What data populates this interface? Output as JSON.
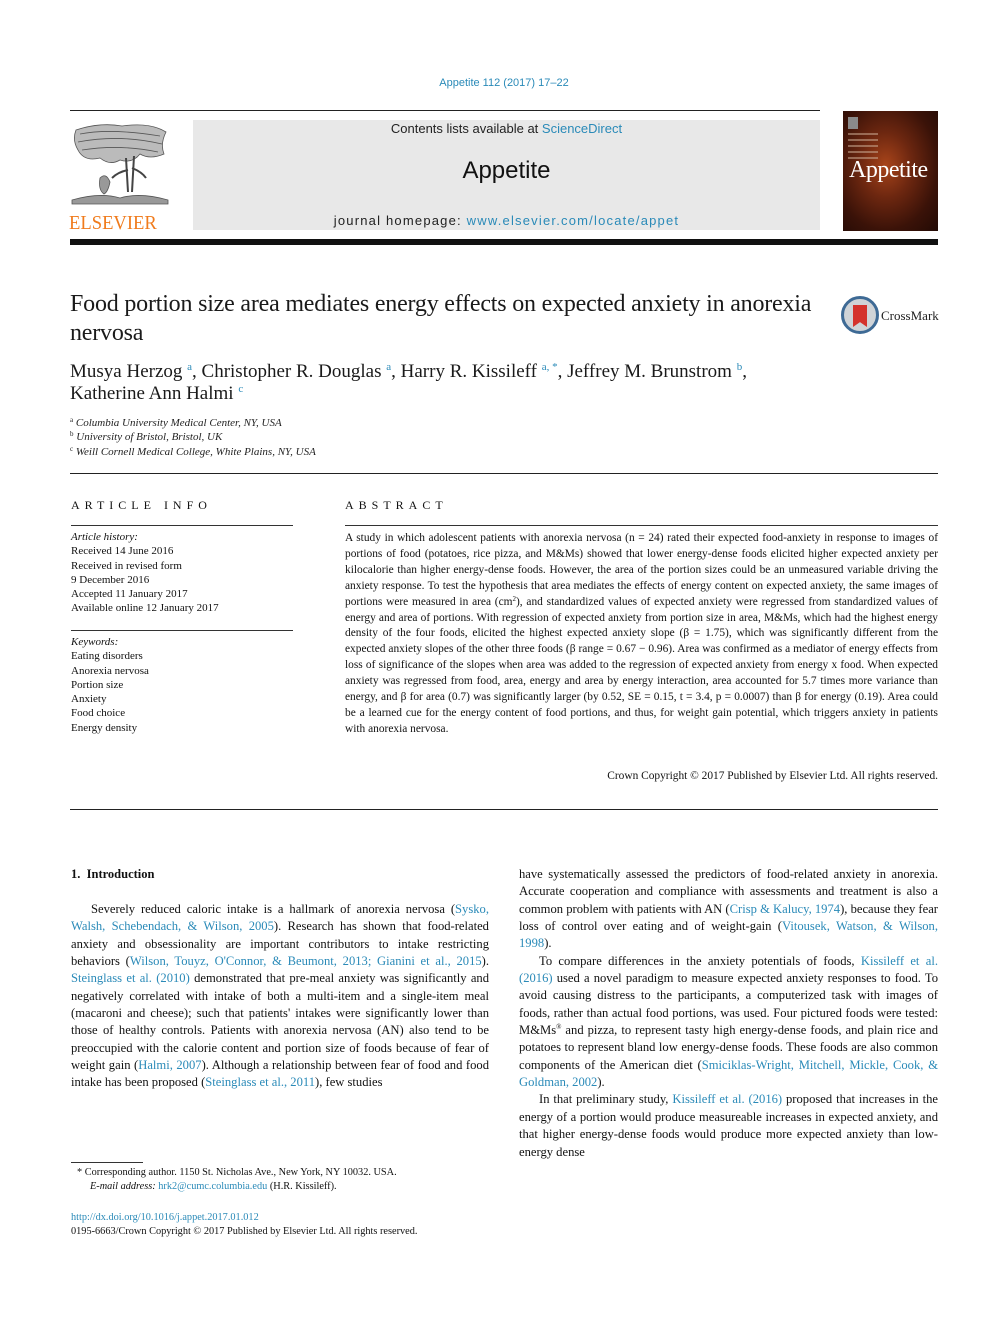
{
  "header": {
    "citation": "Appetite 112 (2017) 17–22",
    "publisher_logo": "ELSEVIER",
    "contents_prefix": "Contents lists available at ",
    "contents_link": "ScienceDirect",
    "journal_name": "Appetite",
    "homepage_prefix": "journal homepage: ",
    "homepage_link": "www.elsevier.com/locate/appet",
    "cover_title": "Appetite"
  },
  "colors": {
    "link": "#2a8ab8",
    "elsevier_orange": "#f07b1c",
    "masthead_bg": "#e8e8e8"
  },
  "article": {
    "title": "Food portion size area mediates energy effects on expected anxiety in anorexia nervosa",
    "crossmark_label": "CrossMark",
    "authors": [
      {
        "name": "Musya Herzog",
        "sup": "a",
        "sep": ", "
      },
      {
        "name": "Christopher R. Douglas",
        "sup": "a",
        "sep": ", "
      },
      {
        "name": "Harry R. Kissileff",
        "sup": "a, *",
        "sep": ", "
      },
      {
        "name": "Jeffrey M. Brunstrom",
        "sup": "b",
        "sep": ","
      },
      {
        "name": "Katherine Ann Halmi",
        "sup": "c",
        "sep": ""
      }
    ],
    "affiliations": [
      {
        "key": "a",
        "text": "Columbia University Medical Center, NY, USA"
      },
      {
        "key": "b",
        "text": "University of Bristol, Bristol, UK"
      },
      {
        "key": "c",
        "text": "Weill Cornell Medical College, White Plains, NY, USA"
      }
    ]
  },
  "article_info": {
    "heading": "ARTICLE INFO",
    "history_label": "Article history:",
    "history": [
      "Received 14 June 2016",
      "Received in revised form",
      "9 December 2016",
      "Accepted 11 January 2017",
      "Available online 12 January 2017"
    ],
    "keywords_label": "Keywords:",
    "keywords": [
      "Eating disorders",
      "Anorexia nervosa",
      "Portion size",
      "Anxiety",
      "Food choice",
      "Energy density"
    ]
  },
  "abstract": {
    "heading": "ABSTRACT",
    "text_part1": "A study in which adolescent patients with anorexia nervosa (n = 24) rated their expected food-anxiety in response to images of portions of food (potatoes, rice pizza, and M&Ms) showed that lower energy-dense foods elicited higher expected anxiety per kilocalorie than higher energy-dense foods. However, the area of the portion sizes could be an unmeasured variable driving the anxiety response. To test the hypothesis that area mediates the effects of energy content on expected anxiety, the same images of portions were measured in area (cm",
    "text_sup": "2",
    "text_part2": "), and standardized values of expected anxiety were regressed from standardized values of energy and area of portions. With regression of expected anxiety from portion size in area, M&Ms, which had the highest energy density of the four foods, elicited the highest expected anxiety slope (β = 1.75), which was significantly different from the expected anxiety slopes of the other three foods (β range = 0.67 − 0.96). Area was confirmed as a mediator of energy effects from loss of significance of the slopes when area was added to the regression of expected anxiety from energy x food. When expected anxiety was regressed from food, area, energy and area by energy interaction, area accounted for 5.7 times more variance than energy, and β for area (0.7) was significantly larger (by 0.52, SE = 0.15, t = 3.4, p = 0.0007) than β for energy (0.19). Area could be a learned cue for the energy content of food portions, and thus, for weight gain potential, which triggers anxiety in patients with anorexia nervosa.",
    "copyright": "Crown Copyright © 2017 Published by Elsevier Ltd. All rights reserved."
  },
  "introduction": {
    "heading": "1.  Introduction",
    "left_col": {
      "p1": [
        {
          "t": "Severely reduced caloric intake is a hallmark of anorexia nervosa ("
        },
        {
          "t": "Sysko, Walsh, Schebendach, & Wilson, 2005",
          "link": true
        },
        {
          "t": "). Research has shown that food-related anxiety and obsessionality are important contributors to intake restricting behaviors ("
        },
        {
          "t": "Wilson, Touyz, O'Connor, & Beumont, 2013; Gianini et al., 2015",
          "link": true
        },
        {
          "t": "). "
        },
        {
          "t": "Steinglass et al. (2010)",
          "link": true
        },
        {
          "t": " demonstrated that pre-meal anxiety was significantly and negatively correlated with intake of both a multi-item and a single-item meal (macaroni and cheese); such that patients' intakes were significantly lower than those of healthy controls. Patients with anorexia nervosa (AN) also tend to be preoccupied with the calorie content and portion size of foods because of fear of weight gain ("
        },
        {
          "t": "Halmi, 2007",
          "link": true
        },
        {
          "t": "). Although a relationship between fear of food and food intake has been proposed ("
        },
        {
          "t": "Steinglass et al., 2011",
          "link": true
        },
        {
          "t": "), few studies"
        }
      ]
    },
    "right_col": {
      "p1": [
        {
          "t": "have systematically assessed the predictors of food-related anxiety in anorexia. Accurate cooperation and compliance with assessments and treatment is also a common problem with patients with AN ("
        },
        {
          "t": "Crisp & Kalucy, 1974",
          "link": true
        },
        {
          "t": "), because they fear loss of control over eating and of weight-gain ("
        },
        {
          "t": "Vitousek, Watson, & Wilson, 1998",
          "link": true
        },
        {
          "t": ")."
        }
      ],
      "p2": [
        {
          "t": "To compare differences in the anxiety potentials of foods, "
        },
        {
          "t": "Kissileff et al. (2016)",
          "link": true
        },
        {
          "t": " used a novel paradigm to measure expected anxiety responses to food. To avoid causing distress to the participants, a computerized task with images of foods, rather than actual food portions, was used. Four pictured foods were tested: M&Ms"
        },
        {
          "t": "®",
          "sup": true
        },
        {
          "t": " and pizza, to represent tasty high energy-dense foods, and plain rice and potatoes to represent bland low energy-dense foods. These foods are also common components of the American diet ("
        },
        {
          "t": "Smiciklas-Wright, Mitchell, Mickle, Cook, & Goldman, 2002",
          "link": true
        },
        {
          "t": ")."
        }
      ],
      "p3": [
        {
          "t": "In that preliminary study, "
        },
        {
          "t": "Kissileff et al. (2016)",
          "link": true
        },
        {
          "t": " proposed that increases in the energy of a portion would produce measureable increases in expected anxiety, and that higher energy-dense foods would produce more expected anxiety than low-energy dense"
        }
      ]
    }
  },
  "footnotes": {
    "corresponding": "*  Corresponding author. 1150 St. Nicholas Ave., New York, NY 10032. USA.",
    "email_label": "E-mail address: ",
    "email": "hrk2@cumc.columbia.edu",
    "email_suffix": " (H.R. Kissileff).",
    "doi": "http://dx.doi.org/10.1016/j.appet.2017.01.012",
    "issn_copyright": "0195-6663/Crown Copyright © 2017 Published by Elsevier Ltd. All rights reserved."
  }
}
